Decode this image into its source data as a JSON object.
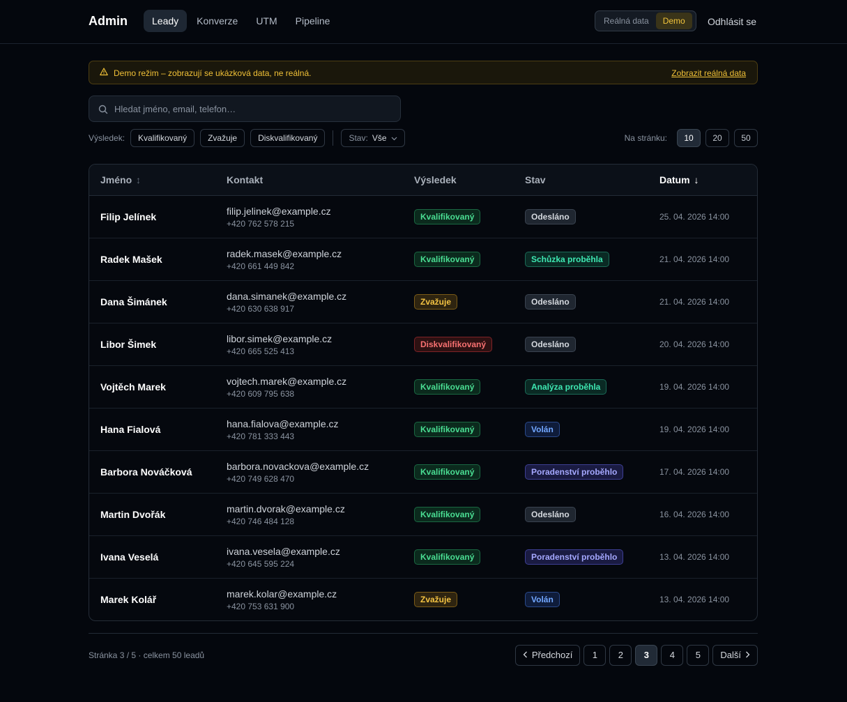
{
  "header": {
    "brand": "Admin",
    "nav": [
      "Leady",
      "Konverze",
      "UTM",
      "Pipeline"
    ],
    "active_nav": "Leady",
    "mode_real": "Reálná data",
    "mode_demo": "Demo",
    "logout": "Odhlásit se"
  },
  "banner": {
    "icon": "warning-icon",
    "text": "Demo režim – zobrazují se ukázková data, ne reálná.",
    "link": "Zobrazit reálná data"
  },
  "search": {
    "placeholder": "Hledat jméno, email, telefon…",
    "value": ""
  },
  "filters": {
    "result_label": "Výsledek:",
    "chips": [
      "Kvalifikovaný",
      "Zvažuje",
      "Diskvalifikovaný"
    ],
    "state_label": "Stav:",
    "state_value": "Vše"
  },
  "per_page": {
    "label": "Na stránku:",
    "options": [
      "10",
      "20",
      "50"
    ],
    "selected": "10"
  },
  "table": {
    "columns": {
      "name": "Jméno",
      "contact": "Kontakt",
      "result": "Výsledek",
      "state": "Stav",
      "date": "Datum"
    },
    "rows": [
      {
        "name": "Filip Jelínek",
        "email": "filip.jelinek@example.cz",
        "phone": "+420 762 578 215",
        "result": "Kvalifikovaný",
        "result_color": "green",
        "state": "Odesláno",
        "state_color": "gray",
        "date": "25. 04. 2026 14:00"
      },
      {
        "name": "Radek Mašek",
        "email": "radek.masek@example.cz",
        "phone": "+420 661 449 842",
        "result": "Kvalifikovaný",
        "result_color": "green",
        "state": "Schůzka proběhla",
        "state_color": "teal",
        "date": "21. 04. 2026 14:00"
      },
      {
        "name": "Dana Šimánek",
        "email": "dana.simanek@example.cz",
        "phone": "+420 630 638 917",
        "result": "Zvažuje",
        "result_color": "yellow",
        "state": "Odesláno",
        "state_color": "gray",
        "date": "21. 04. 2026 14:00"
      },
      {
        "name": "Libor Šimek",
        "email": "libor.simek@example.cz",
        "phone": "+420 665 525 413",
        "result": "Diskvalifikovaný",
        "result_color": "red",
        "state": "Odesláno",
        "state_color": "gray",
        "date": "20. 04. 2026 14:00"
      },
      {
        "name": "Vojtěch Marek",
        "email": "vojtech.marek@example.cz",
        "phone": "+420 609 795 638",
        "result": "Kvalifikovaný",
        "result_color": "green",
        "state": "Analýza proběhla",
        "state_color": "teal",
        "date": "19. 04. 2026 14:00"
      },
      {
        "name": "Hana Fialová",
        "email": "hana.fialova@example.cz",
        "phone": "+420 781 333 443",
        "result": "Kvalifikovaný",
        "result_color": "green",
        "state": "Volán",
        "state_color": "blue",
        "date": "19. 04. 2026 14:00"
      },
      {
        "name": "Barbora Nováčková",
        "email": "barbora.novackova@example.cz",
        "phone": "+420 749 628 470",
        "result": "Kvalifikovaný",
        "result_color": "green",
        "state": "Poradenství proběhlo",
        "state_color": "indigo",
        "date": "17. 04. 2026 14:00"
      },
      {
        "name": "Martin Dvořák",
        "email": "martin.dvorak@example.cz",
        "phone": "+420 746 484 128",
        "result": "Kvalifikovaný",
        "result_color": "green",
        "state": "Odesláno",
        "state_color": "gray",
        "date": "16. 04. 2026 14:00"
      },
      {
        "name": "Ivana Veselá",
        "email": "ivana.vesela@example.cz",
        "phone": "+420 645 595 224",
        "result": "Kvalifikovaný",
        "result_color": "green",
        "state": "Poradenství proběhlo",
        "state_color": "indigo",
        "date": "13. 04. 2026 14:00"
      },
      {
        "name": "Marek Kolář",
        "email": "marek.kolar@example.cz",
        "phone": "+420 753 631 900",
        "result": "Zvažuje",
        "result_color": "yellow",
        "state": "Volán",
        "state_color": "blue",
        "date": "13. 04. 2026 14:00"
      }
    ]
  },
  "footer": {
    "page_info": "Stránka 3 / 5 · celkem 50 leadů",
    "prev": "Předchozí",
    "next": "Další",
    "pages": [
      "1",
      "2",
      "3",
      "4",
      "5"
    ],
    "current_page": "3"
  }
}
